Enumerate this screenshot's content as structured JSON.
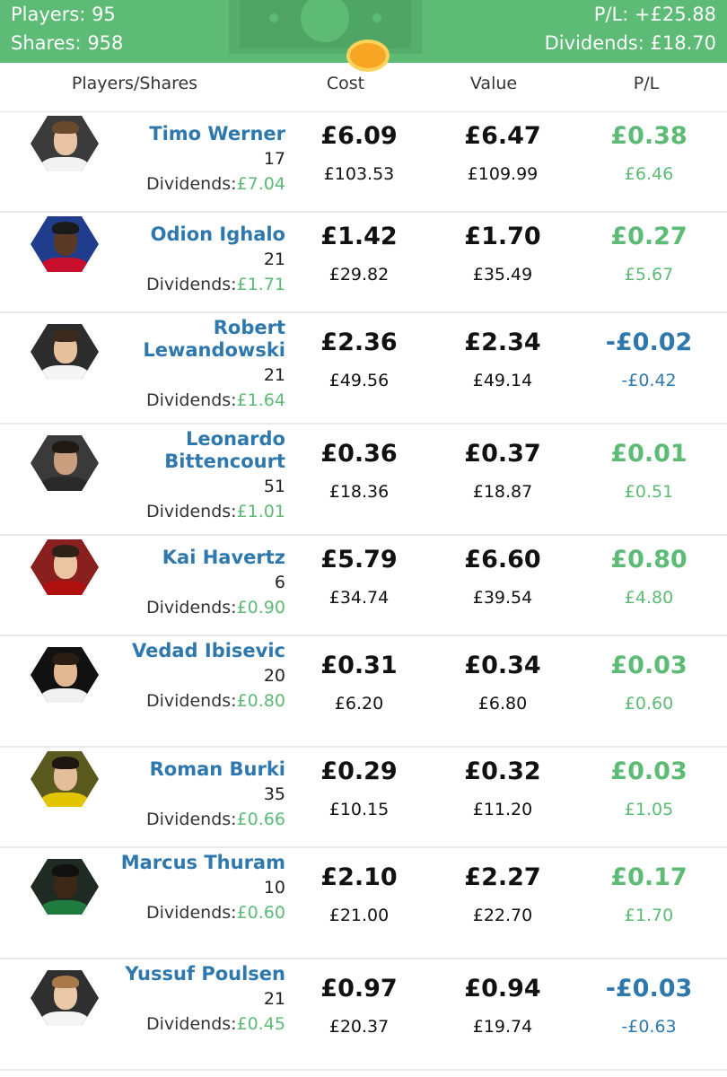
{
  "header": {
    "players_label": "Players:",
    "players_value": "95",
    "shares_label": "Shares:",
    "shares_value": "958",
    "pl_label": "P/L:",
    "pl_value": "+£25.88",
    "dividends_label": "Dividends:",
    "dividends_value": "£18.70",
    "icons": [
      "money-icon",
      "coin-icon"
    ]
  },
  "columns": {
    "players": "Players/Shares",
    "cost": "Cost",
    "value": "Value",
    "pl": "P/L"
  },
  "dividends_label": "Dividends:",
  "colors": {
    "header_green": "#5dbb75",
    "positive": "#5dbb75",
    "negative": "#2e78ae",
    "name_blue": "#2e78ae"
  },
  "players": [
    {
      "name": "Timo Werner",
      "shares": "17",
      "dividends": "£7.04",
      "cost": "£6.09",
      "cost_total": "£103.53",
      "value": "£6.47",
      "value_total": "£109.99",
      "pl": "£0.38",
      "pl_total": "£6.46",
      "pl_sign": "positive"
    },
    {
      "name": "Odion Ighalo",
      "shares": "21",
      "dividends": "£1.71",
      "cost": "£1.42",
      "cost_total": "£29.82",
      "value": "£1.70",
      "value_total": "£35.49",
      "pl": "£0.27",
      "pl_total": "£5.67",
      "pl_sign": "positive"
    },
    {
      "name": "Robert Lewandowski",
      "shares": "21",
      "dividends": "£1.64",
      "cost": "£2.36",
      "cost_total": "£49.56",
      "value": "£2.34",
      "value_total": "£49.14",
      "pl": "-£0.02",
      "pl_total": "-£0.42",
      "pl_sign": "negative"
    },
    {
      "name": "Leonardo Bittencourt",
      "shares": "51",
      "dividends": "£1.01",
      "cost": "£0.36",
      "cost_total": "£18.36",
      "value": "£0.37",
      "value_total": "£18.87",
      "pl": "£0.01",
      "pl_total": "£0.51",
      "pl_sign": "positive"
    },
    {
      "name": "Kai Havertz",
      "shares": "6",
      "dividends": "£0.90",
      "cost": "£5.79",
      "cost_total": "£34.74",
      "value": "£6.60",
      "value_total": "£39.54",
      "pl": "£0.80",
      "pl_total": "£4.80",
      "pl_sign": "positive"
    },
    {
      "name": "Vedad Ibisevic",
      "shares": "20",
      "dividends": "£0.80",
      "cost": "£0.31",
      "cost_total": "£6.20",
      "value": "£0.34",
      "value_total": "£6.80",
      "pl": "£0.03",
      "pl_total": "£0.60",
      "pl_sign": "positive"
    },
    {
      "name": "Roman Burki",
      "shares": "35",
      "dividends": "£0.66",
      "cost": "£0.29",
      "cost_total": "£10.15",
      "value": "£0.32",
      "value_total": "£11.20",
      "pl": "£0.03",
      "pl_total": "£1.05",
      "pl_sign": "positive"
    },
    {
      "name": "Marcus Thuram",
      "shares": "10",
      "dividends": "£0.60",
      "cost": "£2.10",
      "cost_total": "£21.00",
      "value": "£2.27",
      "value_total": "£22.70",
      "pl": "£0.17",
      "pl_total": "£1.70",
      "pl_sign": "positive"
    },
    {
      "name": "Yussuf Poulsen",
      "shares": "21",
      "dividends": "£0.45",
      "cost": "£0.97",
      "cost_total": "£20.37",
      "value": "£0.94",
      "value_total": "£19.74",
      "pl": "-£0.03",
      "pl_total": "-£0.63",
      "pl_sign": "negative"
    }
  ]
}
